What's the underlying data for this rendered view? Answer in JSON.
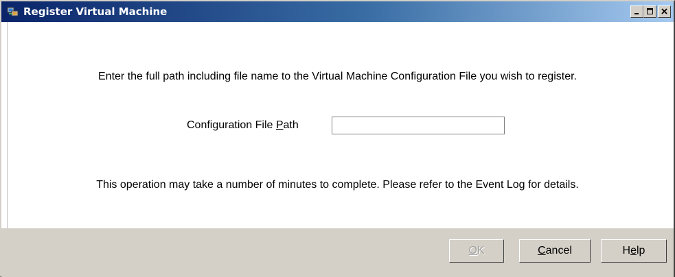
{
  "window": {
    "title": "Register Virtual Machine",
    "icon": "virtual-machine-icon",
    "controls": {
      "minimize_icon": "minimize-icon",
      "maximize_icon": "maximize-icon",
      "close_icon": "close-icon"
    }
  },
  "main": {
    "instruction": "Enter the full path including file name to the Virtual Machine Configuration File you wish to register.",
    "path_field": {
      "label_before_mnemonic": "Configuration File ",
      "label_mnemonic": "P",
      "label_after_mnemonic": "ath",
      "value": "",
      "placeholder": ""
    },
    "note": "This operation may take a number of minutes to complete. Please refer to the Event Log for details."
  },
  "footer": {
    "ok": {
      "before": "",
      "mnemonic": "O",
      "after": "K",
      "disabled": true
    },
    "cancel": {
      "before": "",
      "mnemonic": "C",
      "after": "ancel"
    },
    "help": {
      "before": "H",
      "mnemonic": "e",
      "after": "lp"
    }
  },
  "colors": {
    "titlebar_start": "#0a246a",
    "titlebar_end": "#a6caf0",
    "dialog_face": "#d4d0c8",
    "disabled_text": "#a0a0a0"
  }
}
